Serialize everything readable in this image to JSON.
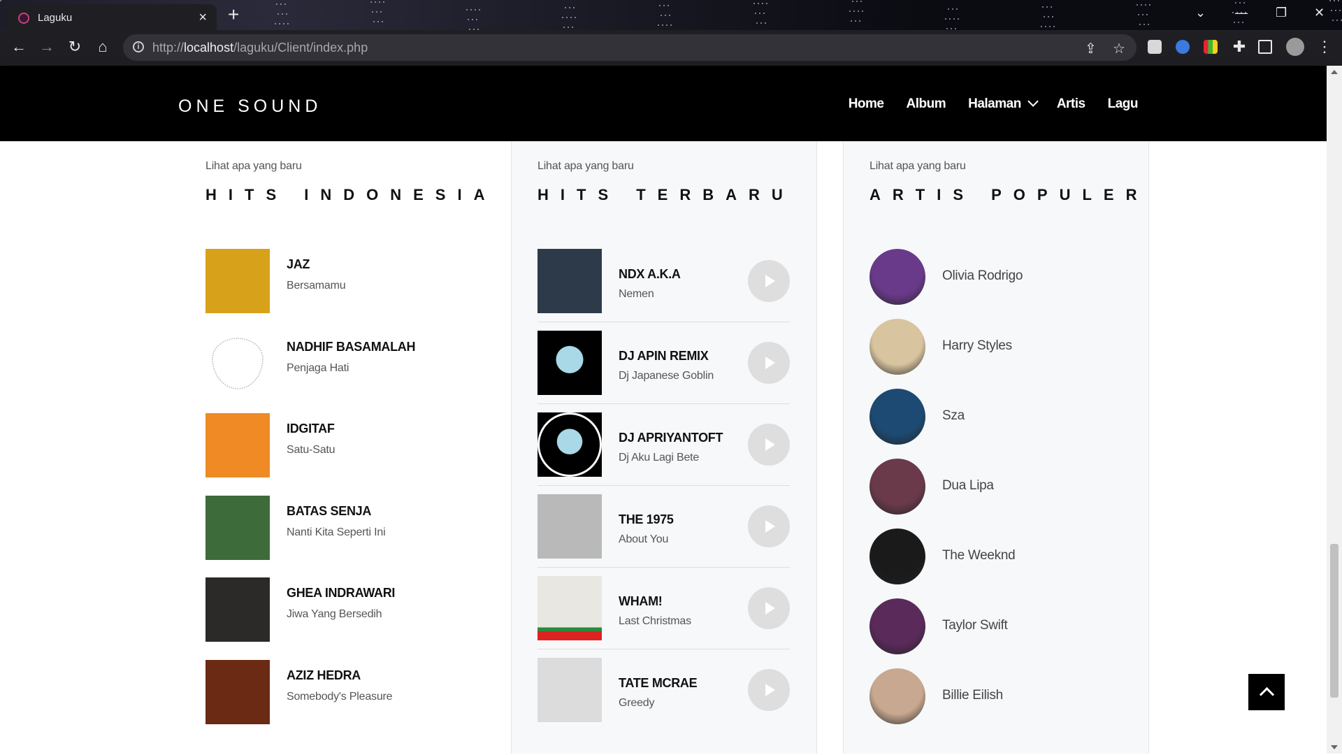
{
  "browser": {
    "tab_title": "Laguku",
    "url_prefix": "http://",
    "url_host": "localhost",
    "url_path": "/laguku/Client/index.php"
  },
  "site": {
    "logo": "ONE SOUND",
    "menu": [
      "Home",
      "Album",
      "Halaman",
      "Artis",
      "Lagu"
    ]
  },
  "sections": {
    "hits_indonesia": {
      "kicker": "Lihat apa yang baru",
      "title": "HITS INDONESIA",
      "items": [
        {
          "artist": "JAZ",
          "song": "Bersamamu",
          "cover": "#d7a21a"
        },
        {
          "artist": "NADHIF BASAMALAH",
          "song": "Penjaga Hati",
          "cover": "#ffffff"
        },
        {
          "artist": "IDGITAF",
          "song": "Satu-Satu",
          "cover": "#f08a24"
        },
        {
          "artist": "BATAS SENJA",
          "song": "Nanti Kita Seperti Ini",
          "cover": "#3d6b3a"
        },
        {
          "artist": "GHEA INDRAWARI",
          "song": "Jiwa Yang Bersedih",
          "cover": "#2c2a28"
        },
        {
          "artist": "AZIZ HEDRA",
          "song": "Somebody's Pleasure",
          "cover": "#6b2a14"
        }
      ]
    },
    "hits_terbaru": {
      "kicker": "Lihat apa yang baru",
      "title": "HITS TERBARU",
      "items": [
        {
          "artist": "NDX A.K.A",
          "song": "Nemen",
          "cover": "#2c3a4a"
        },
        {
          "artist": "DJ APIN REMIX",
          "song": "Dj Japanese Goblin",
          "cover": "#000000"
        },
        {
          "artist": "DJ APRIYANTOFT",
          "song": "Dj Aku Lagi Bete",
          "cover": "#000000"
        },
        {
          "artist": "THE 1975",
          "song": "About You",
          "cover": "#b9b9b9"
        },
        {
          "artist": "WHAM!",
          "song": "Last Christmas",
          "cover": "#e9e7e2"
        },
        {
          "artist": "TATE MCRAE",
          "song": "Greedy",
          "cover": "#dcdcdc"
        }
      ]
    },
    "artis_populer": {
      "kicker": "Lihat apa yang baru",
      "title": "ARTIS POPULER",
      "items": [
        {
          "name": "Olivia Rodrigo",
          "color": "#6a3a8a"
        },
        {
          "name": "Harry Styles",
          "color": "#d9c4a0"
        },
        {
          "name": "Sza",
          "color": "#1d4a72"
        },
        {
          "name": "Dua Lipa",
          "color": "#6a3a4a"
        },
        {
          "name": "The Weeknd",
          "color": "#1a1a1a"
        },
        {
          "name": "Taylor Swift",
          "color": "#5a2a5a"
        },
        {
          "name": "Billie Eilish",
          "color": "#c8a890"
        }
      ]
    }
  }
}
